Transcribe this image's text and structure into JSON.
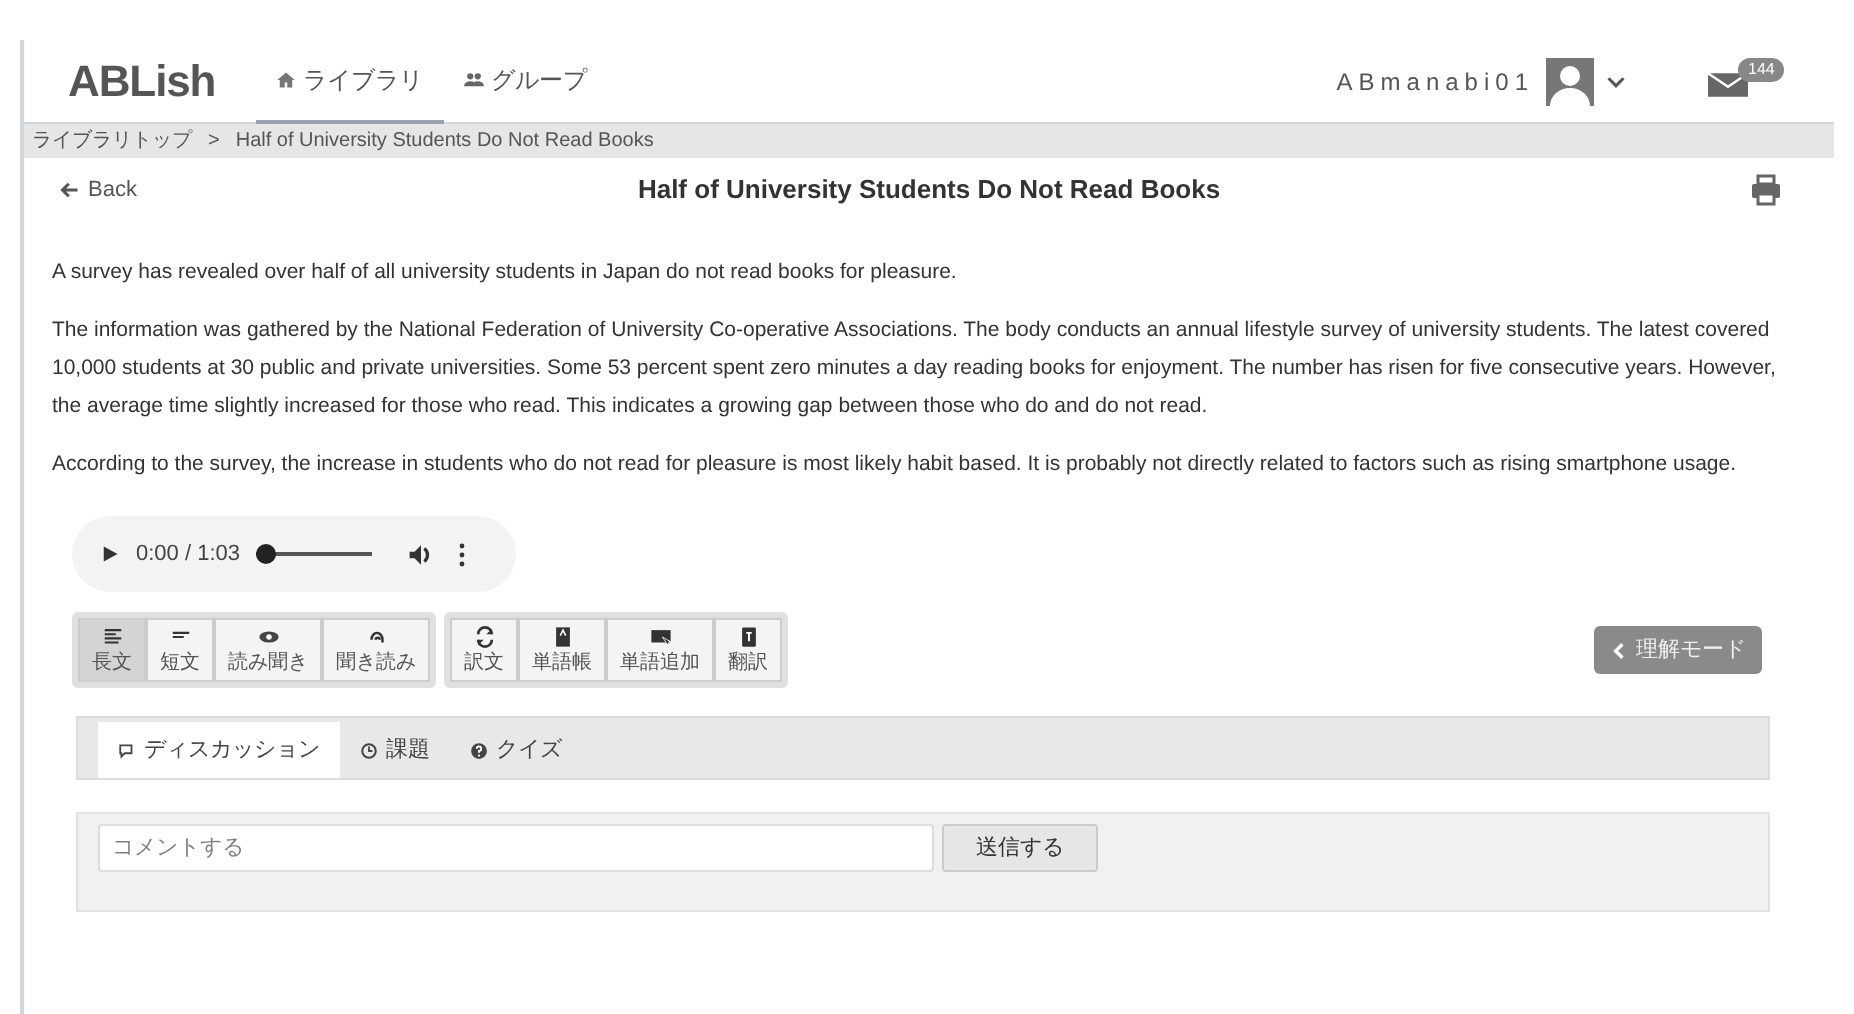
{
  "header": {
    "logo": "ABLish",
    "nav": [
      {
        "label": "ライブラリ",
        "selected": true
      },
      {
        "label": "グループ",
        "selected": false
      }
    ],
    "username": "ABmanabi01",
    "mail_count": "144"
  },
  "breadcrumb": [
    "ライブラリトップ",
    ">",
    "Half of University Students Do Not Read Books"
  ],
  "back": "Back",
  "title": "Half of University Students Do Not Read Books",
  "paragraphs": [
    "A survey has revealed over half of all university students in Japan do not read books for pleasure.",
    "The information was gathered by the National Federation of University Co-operative Associations. The body conducts an annual lifestyle survey of university students. The latest covered 10,000 students at 30 public and private universities. Some 53 percent spent zero minutes a day reading books for enjoyment. The number has risen for five consecutive years. However, the average time slightly increased for those who read. This indicates a growing gap between those who do and do not read.",
    "According to the survey, the increase in students who do not read for pleasure is most likely habit based. It is probably not directly related to factors such as rising smartphone usage."
  ],
  "audio": {
    "time": "0:00 / 1:03",
    "level": 0
  },
  "toolbar_groups": [
    [
      {
        "label": "長文",
        "kind": "lines",
        "selected": true
      },
      {
        "label": "短文",
        "kind": "short",
        "selected": false
      },
      {
        "label": "読み聞き",
        "kind": "eye",
        "selected": false
      },
      {
        "label": "聞き読み",
        "kind": "ear",
        "selected": false
      }
    ],
    [
      {
        "label": "訳文",
        "kind": "refresh",
        "selected": false
      },
      {
        "label": "単語帳",
        "kind": "book",
        "selected": false
      },
      {
        "label": "単語追加",
        "kind": "ab",
        "selected": false
      },
      {
        "label": "翻訳",
        "kind": "translate",
        "selected": false
      }
    ]
  ],
  "mode_button": "理解モード",
  "tabs": [
    {
      "label": "ディスカッション",
      "kind": "chat",
      "selected": true
    },
    {
      "label": "課題",
      "kind": "clock",
      "selected": false
    },
    {
      "label": "クイズ",
      "kind": "question",
      "selected": false
    }
  ],
  "comment": {
    "placeholder": "コメントする",
    "send": "送信する"
  }
}
